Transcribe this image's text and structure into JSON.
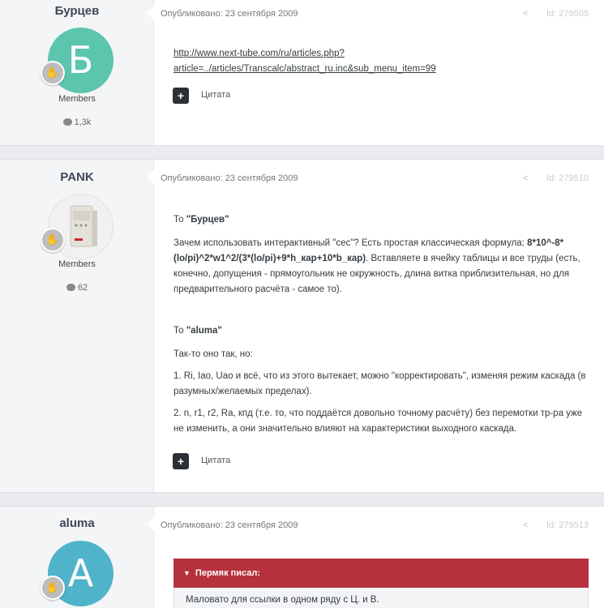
{
  "posts": [
    {
      "author": "Бурцев",
      "avatar_letter": "Б",
      "avatar_color": "#5cc5ae",
      "group": "Members",
      "count": "1,3k",
      "date": "Опубликовано: 23 сентября 2009",
      "id": "Id: 279505",
      "link_line1": "http://www.next-tube.com/ru/articles.php?",
      "link_line2": "article=../articles/Transcalc/abstract_ru.inc&sub_menu_item=99",
      "quote_label": "Цитата"
    },
    {
      "author": "PANK",
      "avatar_image": "ups-device-photo",
      "group": "Members",
      "count": "62",
      "date": "Опубликовано: 23 сентября 2009",
      "id": "Id: 279510",
      "to1_prefix": "То ",
      "to1_name": "\"Бурцев\"",
      "p1_text": "Зачем использовать интерактивный \"сес\"? Есть простая классическая формула: ",
      "p1_formula": "8*10^-8*(lo/pi)^2*w1^2/(3*(lo/pi)+9*h_кар+10*b_кар)",
      "p1_rest": ". Вставляете в ячейку таблицы и все труды (есть, конечно, допущения - прямоугольник не окружность, длина витка приблизительная, но для предварительного расчёта - самое то).",
      "to2_prefix": "То ",
      "to2_name": "\"aluma\"",
      "p2": "Так-то оно так, но:",
      "p3": "1. Ri, Iao, Uao и всё, что из этого вытекает, можно \"корректировать\", изменяя режим каскада (в разумных/желаемых пределах).",
      "p4": "2. n, r1, r2, Ra, кпд (т.е. то, что поддаётся довольно точному расчёту) без перемотки тр-ра уже не изменить, а они значительно влияют на характеристики выходного каскада.",
      "quote_label": "Цитата"
    },
    {
      "author": "aluma",
      "avatar_letter": "A",
      "avatar_color": "#4fb3c9",
      "date": "Опубликовано: 23 сентября 2009",
      "id": "Id: 279513",
      "quote_header": "Пермяк писал:",
      "quote_text": "Маловато для ссылки в одном ряду с Ц. и В."
    }
  ],
  "colors": {
    "quote_header_bg": "#b5313b",
    "rank_badge": "#bdbdbd"
  }
}
